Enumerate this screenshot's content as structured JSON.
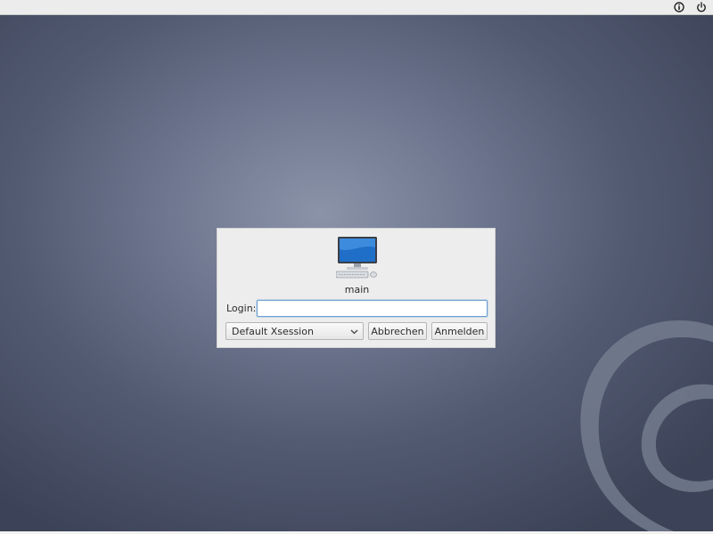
{
  "topbar": {
    "icons": [
      "info-icon",
      "power-icon"
    ]
  },
  "dialog": {
    "icon": "computer-icon",
    "hostname": "main",
    "login_label": "Login:",
    "login_value": "",
    "session_selected": "Default Xsession",
    "cancel_label": "Abbrechen",
    "login_button_label": "Anmelden"
  },
  "background": {
    "logo": "debian-swirl",
    "colors": {
      "center": "#8a93a8",
      "edge": "#3c4358",
      "accent_focus": "#6f9fd3"
    }
  }
}
